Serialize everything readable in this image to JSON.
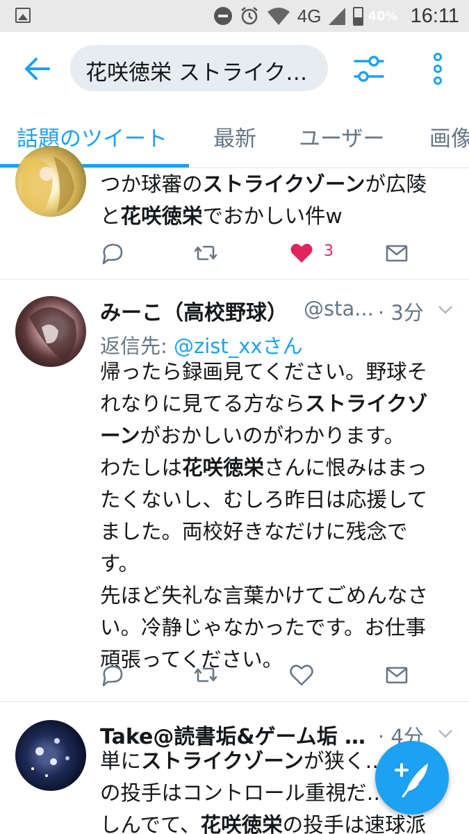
{
  "status_bar": {
    "network": "4G",
    "battery": "40%",
    "time": "16:11"
  },
  "search": {
    "query": "花咲徳栄 ストライク…"
  },
  "tabs": [
    {
      "label": "話題のツイート",
      "active": true
    },
    {
      "label": "最新",
      "active": false
    },
    {
      "label": "ユーザー",
      "active": false
    },
    {
      "label": "画像",
      "active": false
    }
  ],
  "tweets": [
    {
      "body_lines": [
        [
          {
            "t": "つか球審の"
          },
          {
            "t": "ストライクゾーン",
            "b": true
          },
          {
            "t": "が広陵"
          }
        ],
        [
          {
            "t": "と"
          },
          {
            "t": "花咲徳栄",
            "b": true
          },
          {
            "t": "でおかしい件w"
          }
        ]
      ],
      "like_count": "3",
      "liked": true
    },
    {
      "name": "みーこ（高校野球）",
      "handle": "@sta...",
      "time": "· 3分",
      "reply_prefix": "返信先: ",
      "reply_to": "@zist_xxさん",
      "body_lines": [
        [
          {
            "t": "帰ったら録画見てください。野球そ"
          }
        ],
        [
          {
            "t": "れなりに見てる方なら"
          },
          {
            "t": "ストライクゾ",
            "b": true
          }
        ],
        [
          {
            "t": "ーン",
            "b": true
          },
          {
            "t": "がおかしいのがわかります。"
          }
        ],
        [
          {
            "t": "わたしは"
          },
          {
            "t": "花咲徳栄",
            "b": true
          },
          {
            "t": "さんに恨みはまっ"
          }
        ],
        [
          {
            "t": "たくないし、むしろ昨日は応援して"
          }
        ],
        [
          {
            "t": "ました。両校好きなだけに残念で"
          }
        ],
        [
          {
            "t": "す。"
          }
        ],
        [
          {
            "t": "先ほど失礼な言葉かけてごめんなさ"
          }
        ],
        [
          {
            "t": "い。冷静じゃなかったです。お仕事"
          }
        ],
        [
          {
            "t": "頑張ってください。"
          }
        ]
      ]
    },
    {
      "name": "Take@読書垢&ゲーム垢 …",
      "time": "· 4分",
      "body_lines": [
        [
          {
            "t": "単に"
          },
          {
            "t": "ストライクゾーン",
            "b": true
          },
          {
            "t": "が狭く…陵"
          }
        ],
        [
          {
            "t": "の投手はコントロール重視だ…苦"
          }
        ],
        [
          {
            "t": "しんでて、"
          },
          {
            "t": "花咲徳栄",
            "b": true
          },
          {
            "t": "の投手は速球派"
          }
        ]
      ]
    }
  ],
  "colors": {
    "accent": "#1da1f2",
    "like": "#e0245e",
    "muted": "#657786"
  }
}
